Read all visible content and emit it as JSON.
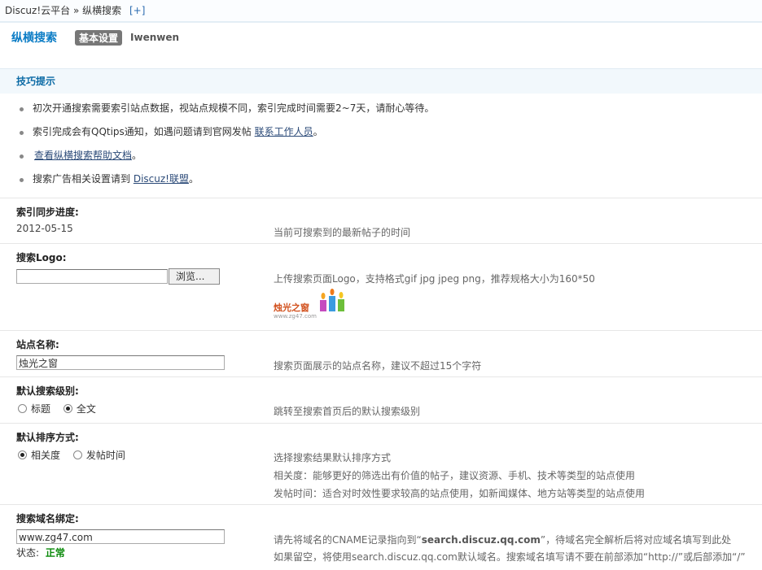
{
  "breadcrumb": {
    "root": "Discuz!云平台",
    "separator": "»",
    "current": "纵横搜索",
    "add_label": "[+]"
  },
  "header": {
    "title": "纵横搜索",
    "tabs": [
      {
        "label": "基本设置",
        "active": true
      },
      {
        "label": "Iwenwen",
        "active": false
      }
    ]
  },
  "tips": {
    "heading": "技巧提示",
    "items": [
      {
        "text": "初次开通搜索需要索引站点数据，视站点规模不同，索引完成时间需要2~7天，请耐心等待。"
      },
      {
        "pre": "索引完成会有QQtips通知，如遇问题请到官网发帖 ",
        "link": "联系工作人员",
        "post": "。"
      },
      {
        "pre": "",
        "link": "查看纵横搜索帮助文档",
        "post": "。"
      },
      {
        "pre": "搜索广告相关设置请到 ",
        "link": "Discuz!联盟",
        "post": "。"
      }
    ]
  },
  "sync": {
    "label": "索引同步进度:",
    "value": "2012-05-15",
    "desc": "当前可搜索到的最新帖子的时间"
  },
  "logo": {
    "label": "搜索Logo:",
    "browse_label": "浏览...",
    "desc": "上传搜索页面Logo，支持格式gif jpg jpeg png，推荐规格大小为160*50",
    "preview_text": "烛光之窗",
    "preview_sub": "www.zg47.com"
  },
  "site_name": {
    "label": "站点名称:",
    "value": "烛光之窗",
    "desc": "搜索页面展示的站点名称，建议不超过15个字符"
  },
  "search_level": {
    "label": "默认搜索级别:",
    "options": [
      {
        "label": "标题",
        "checked": false
      },
      {
        "label": "全文",
        "checked": true
      }
    ],
    "desc": "跳转至搜索首页后的默认搜索级别"
  },
  "sort": {
    "label": "默认排序方式:",
    "options": [
      {
        "label": "相关度",
        "checked": true
      },
      {
        "label": "发帖时间",
        "checked": false
      }
    ],
    "desc_lines": [
      "选择搜索结果默认排序方式",
      "相关度：能够更好的筛选出有价值的帖子，建议资源、手机、技术等类型的站点使用",
      "发帖时间：适合对时效性要求较高的站点使用，如新闻媒体、地方站等类型的站点使用"
    ]
  },
  "domain": {
    "label": "搜索域名绑定:",
    "value": "www.zg47.com",
    "status_label": "状态:",
    "status_value": "正常",
    "desc_line1_pre": "请先将域名的CNAME记录指向到“",
    "desc_line1_host": "search.discuz.qq.com",
    "desc_line1_post": "”，待域名完全解析后将对应域名填写到此处",
    "desc_line2": "如果留空，将使用search.discuz.qq.com默认域名。搜索域名填写请不要在前部添加“http://”或后部添加“/”"
  },
  "colors": {
    "accent": "#0b7cc5",
    "status_ok": "#0a8a0a",
    "tips_bg": "#f2f8fc"
  }
}
